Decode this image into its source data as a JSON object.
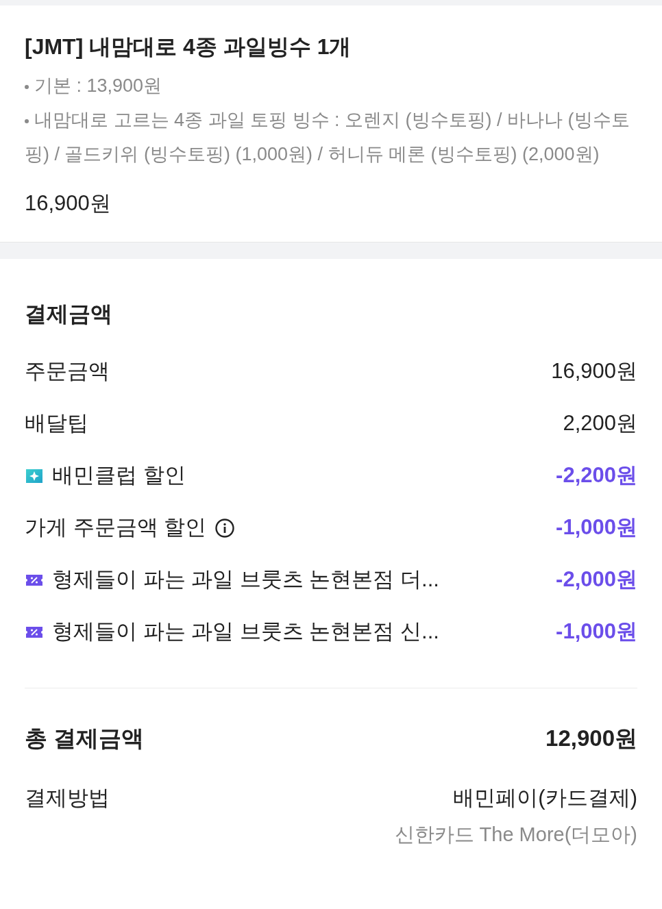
{
  "item": {
    "title": "[JMT] 내맘대로 4종 과일빙수 1개",
    "options": [
      "기본 : 13,900원",
      "내맘대로 고르는 4종 과일 토핑 빙수 : 오렌지 (빙수토핑) / 바나나 (빙수토핑) / 골드키위 (빙수토핑) (1,000원) / 허니듀 메론 (빙수토핑) (2,000원)"
    ],
    "price": "16,900원"
  },
  "payment": {
    "heading": "결제금액",
    "rows": [
      {
        "kind": "plain",
        "label": "주문금액",
        "amount": "16,900원",
        "discount": false
      },
      {
        "kind": "plain",
        "label": "배달팁",
        "amount": "2,200원",
        "discount": false
      },
      {
        "kind": "club",
        "label": "배민클럽 할인",
        "amount": "-2,200원",
        "discount": true
      },
      {
        "kind": "info",
        "label": "가게 주문금액 할인",
        "amount": "-1,000원",
        "discount": true
      },
      {
        "kind": "coupon",
        "label": "형제들이 파는 과일 브룻츠 논현본점 더...",
        "amount": "-2,000원",
        "discount": true
      },
      {
        "kind": "coupon",
        "label": "형제들이 파는 과일 브룻츠 논현본점 신...",
        "amount": "-1,000원",
        "discount": true
      }
    ],
    "total_label": "총 결제금액",
    "total": "12,900원",
    "method_label": "결제방법",
    "method": "배민페이(카드결제)",
    "card": "신한카드 The More(더모아)"
  }
}
